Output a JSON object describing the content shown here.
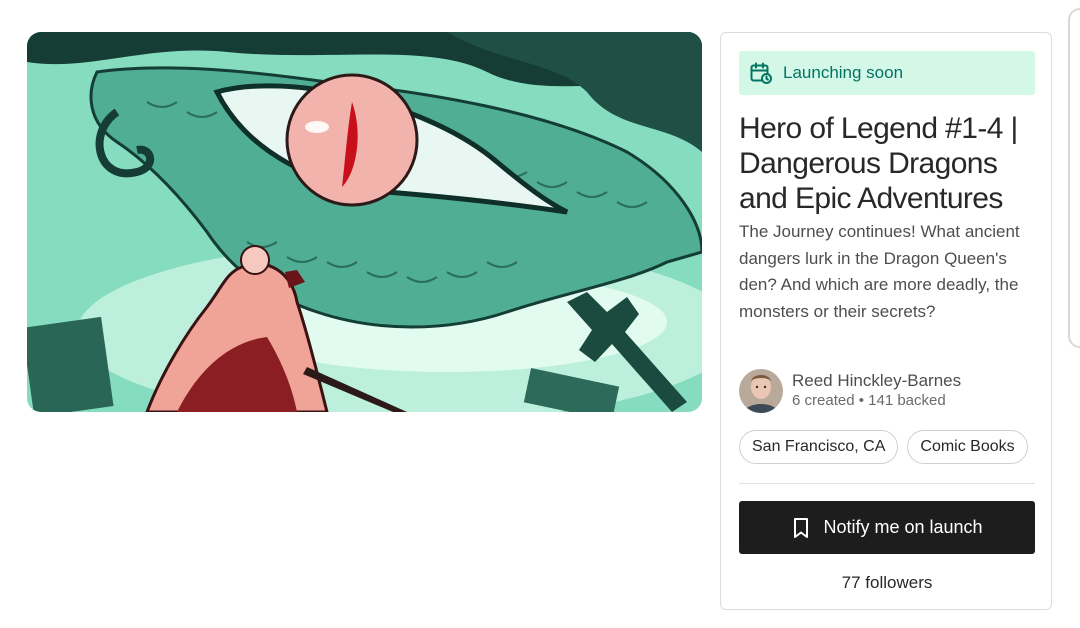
{
  "project": {
    "image_alt": "Dragon eye comic cover art",
    "status_label": "Launching soon",
    "status_icon": "calendar-clock-icon",
    "title": "Hero of Legend #1-4 | Dangerous Dragons and Epic Adventures",
    "description": "The Journey continues! What ancient dangers lurk in the Dragon Queen's den? And which are more deadly, the monsters or their secrets?",
    "creator": {
      "name": "Reed Hinckley-Barnes",
      "created": "6 created",
      "backed": "141 backed"
    },
    "tags": [
      "San Francisco, CA",
      "Comic Books"
    ],
    "notify_label": "Notify me on launch",
    "notify_icon": "bookmark-icon",
    "followers": "77 followers"
  },
  "colors": {
    "badge_bg": "#d4f8e8",
    "badge_text": "#037362",
    "button_bg": "#1d1d1d",
    "art_teal": "#7fd8b8",
    "art_pink": "#f4a79c"
  }
}
